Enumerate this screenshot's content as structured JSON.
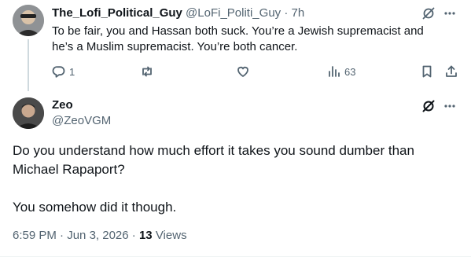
{
  "reply": {
    "name": "The_Lofi_Political_Guy",
    "handle": "@LoFi_Politi_Guy",
    "separator": "·",
    "time": "7h",
    "text": "To be fair, you and Hassan both suck. You’re a Jewish supremacist and he’s a Muslim supremacist. You’re both cancer.",
    "reply_count": "1",
    "view_count": "63",
    "icons": [
      "grok-icon",
      "more-icon",
      "reply-icon",
      "retweet-icon",
      "like-icon",
      "views-icon",
      "bookmark-icon",
      "share-icon"
    ]
  },
  "main": {
    "name": "Zeo",
    "handle": "@ZeoVGM",
    "text_line1": "Do you understand how much effort it takes you sound dumber than Michael Rapaport?",
    "text_line2": "You somehow did it though.",
    "time": "6:59 PM",
    "separator": "·",
    "date": "Jun 3, 2026",
    "views_count": "13",
    "views_label": "Views",
    "icons": [
      "grok-icon",
      "more-icon"
    ]
  },
  "colors": {
    "text": "#0f1419",
    "muted": "#536471",
    "thread_line": "#cfd9de"
  }
}
